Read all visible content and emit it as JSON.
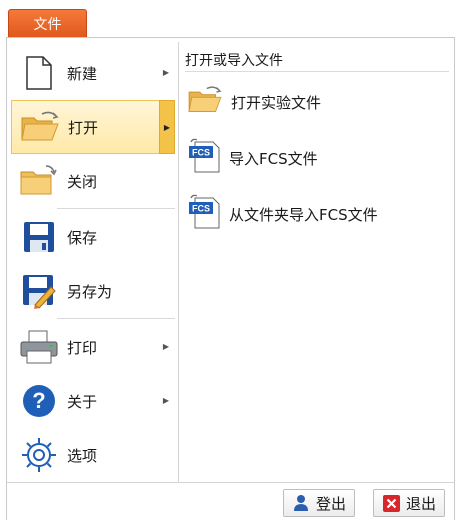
{
  "tab": {
    "label": "文件"
  },
  "menu": {
    "items": [
      {
        "label": "新建",
        "icon": "new-document-icon",
        "has_submenu": true
      },
      {
        "label": "打开",
        "icon": "open-folder-icon",
        "has_submenu": true,
        "active": true
      },
      {
        "label": "关闭",
        "icon": "close-folder-icon",
        "has_submenu": false
      },
      {
        "label": "保存",
        "icon": "save-icon",
        "has_submenu": false
      },
      {
        "label": "另存为",
        "icon": "save-as-icon",
        "has_submenu": false
      },
      {
        "label": "打印",
        "icon": "printer-icon",
        "has_submenu": true
      },
      {
        "label": "关于",
        "icon": "help-icon",
        "has_submenu": true
      },
      {
        "label": "选项",
        "icon": "gear-icon",
        "has_submenu": false
      }
    ]
  },
  "submenu": {
    "title": "打开或导入文件",
    "items": [
      {
        "label": "打开实验文件",
        "icon": "open-folder-icon"
      },
      {
        "label": "导入FCS文件",
        "icon": "fcs-file-icon"
      },
      {
        "label": "从文件夹导入FCS文件",
        "icon": "fcs-file-icon"
      }
    ]
  },
  "footer": {
    "logout_label": "登出",
    "exit_label": "退出"
  },
  "colors": {
    "accent": "#e8622a",
    "active_bg": "#ffe9a8",
    "active_border": "#f0c35a"
  }
}
